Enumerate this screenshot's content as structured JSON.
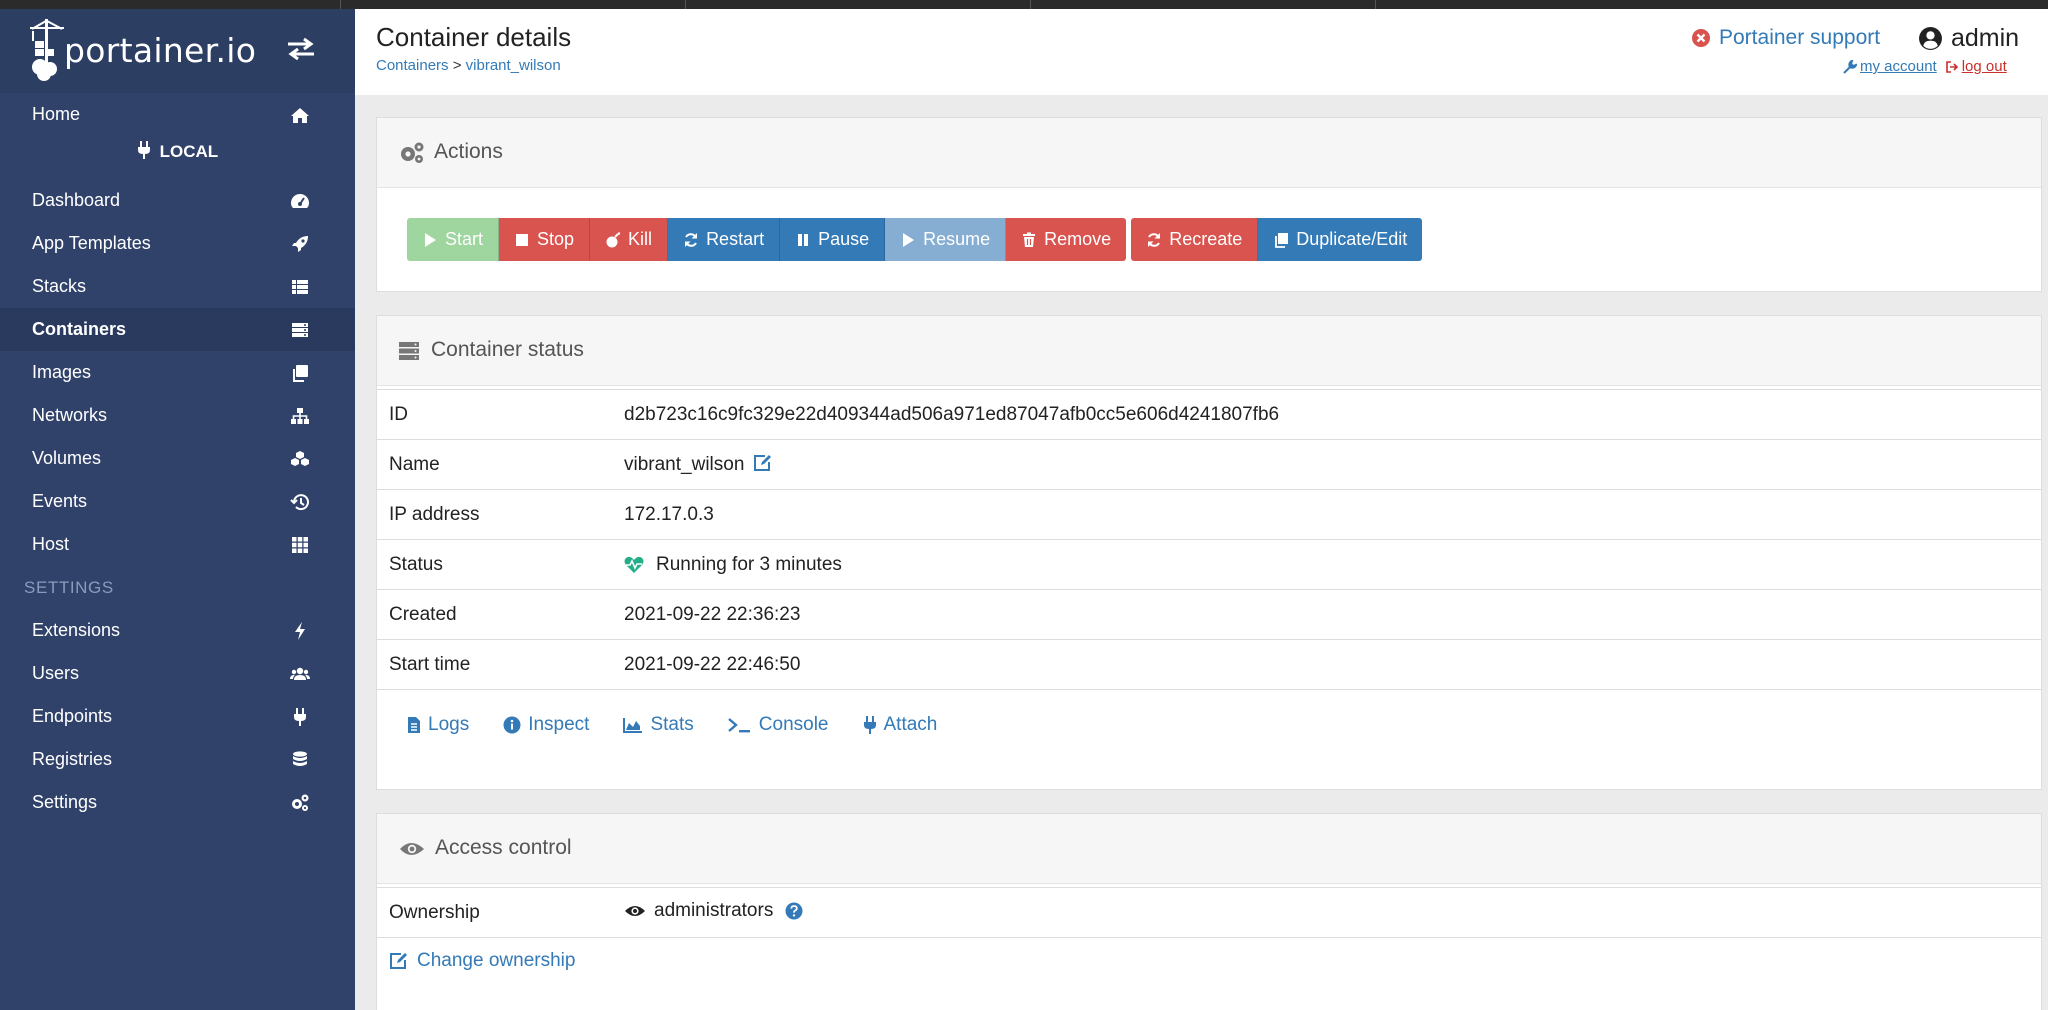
{
  "app": {
    "logo_text": "portainer.io"
  },
  "sidebar": {
    "home": "Home",
    "endpoint_label": "LOCAL",
    "items": [
      {
        "label": "Dashboard",
        "icon": "tachometer-icon"
      },
      {
        "label": "App Templates",
        "icon": "rocket-icon"
      },
      {
        "label": "Stacks",
        "icon": "list-icon"
      },
      {
        "label": "Containers",
        "icon": "server-icon",
        "active": true
      },
      {
        "label": "Images",
        "icon": "clone-icon"
      },
      {
        "label": "Networks",
        "icon": "sitemap-icon"
      },
      {
        "label": "Volumes",
        "icon": "cubes-icon"
      },
      {
        "label": "Events",
        "icon": "history-icon"
      },
      {
        "label": "Host",
        "icon": "th-icon"
      }
    ],
    "settings_header": "SETTINGS",
    "settings_items": [
      {
        "label": "Extensions",
        "icon": "bolt-icon"
      },
      {
        "label": "Users",
        "icon": "users-icon"
      },
      {
        "label": "Endpoints",
        "icon": "plug-icon"
      },
      {
        "label": "Registries",
        "icon": "database-icon"
      },
      {
        "label": "Settings",
        "icon": "cogs-icon"
      }
    ]
  },
  "header": {
    "title": "Container details",
    "breadcrumb_root": "Containers",
    "breadcrumb_sep": ">",
    "breadcrumb_current": "vibrant_wilson",
    "support": "Portainer support",
    "user": "admin",
    "my_account": "my account",
    "log_out": "log out"
  },
  "actions": {
    "title": "Actions",
    "start": "Start",
    "stop": "Stop",
    "kill": "Kill",
    "restart": "Restart",
    "pause": "Pause",
    "resume": "Resume",
    "remove": "Remove",
    "recreate": "Recreate",
    "duplicate": "Duplicate/Edit"
  },
  "status": {
    "title": "Container status",
    "rows": {
      "id_label": "ID",
      "id_value": "d2b723c16c9fc329e22d409344ad506a971ed87047afb0cc5e606d4241807fb6",
      "name_label": "Name",
      "name_value": "vibrant_wilson",
      "ip_label": "IP address",
      "ip_value": "172.17.0.3",
      "status_label": "Status",
      "status_value": "Running for 3 minutes",
      "created_label": "Created",
      "created_value": "2021-09-22 22:36:23",
      "start_label": "Start time",
      "start_value": "2021-09-22 22:46:50"
    },
    "links": {
      "logs": "Logs",
      "inspect": "Inspect",
      "stats": "Stats",
      "console": "Console",
      "attach": "Attach"
    }
  },
  "access": {
    "title": "Access control",
    "ownership_label": "Ownership",
    "ownership_value": "administrators",
    "change": "Change ownership"
  },
  "colors": {
    "sidebar_bg": "#30426a",
    "link": "#337ab7",
    "danger": "#d9534f",
    "success_light": "#9fd59f",
    "status_green": "#23ae89"
  }
}
